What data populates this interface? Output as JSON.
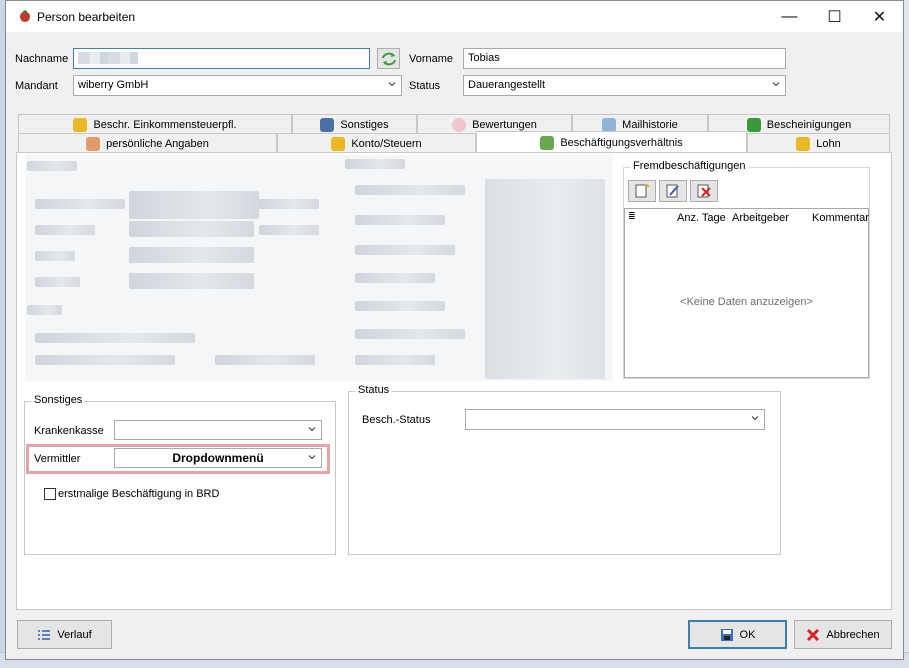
{
  "window": {
    "title": "Person bearbeiten",
    "minimize": "—",
    "maximize": "☐",
    "close": "✕"
  },
  "form": {
    "nachname_label": "Nachname",
    "vorname_label": "Vorname",
    "vorname_value": "Tobias",
    "mandant_label": "Mandant",
    "mandant_value": "wiberry GmbH",
    "status_label": "Status",
    "status_value": "Dauerangestellt"
  },
  "tabs_row1": [
    {
      "label": "Beschr. Einkommensteuerpfl.",
      "icon": "coins-icon"
    },
    {
      "label": "Sonstiges",
      "icon": "car-icon"
    },
    {
      "label": "Bewertungen",
      "icon": "heart-icon"
    },
    {
      "label": "Mailhistorie",
      "icon": "mail-icon"
    },
    {
      "label": "Bescheinigungen",
      "icon": "check-icon"
    }
  ],
  "tabs_row2": [
    {
      "label": "persönliche Angaben",
      "icon": "person-icon"
    },
    {
      "label": "Konto/Steuern",
      "icon": "coins-icon"
    },
    {
      "label": "Beschäftigungsverhältnis",
      "icon": "person-add-icon"
    },
    {
      "label": "Lohn",
      "icon": "coins-icon"
    }
  ],
  "fremd": {
    "title": "Fremdbeschäftigungen",
    "columns": [
      "Anz. Tage",
      "Arbeitgeber",
      "Kommentar"
    ],
    "empty": "<Keine Daten anzuzeigen>"
  },
  "sonstiges": {
    "title": "Sonstiges",
    "krankenkasse_label": "Krankenkasse",
    "vermittler_label": "Vermittler",
    "vermittler_value": "Dropdownmenü",
    "erstmalig_label": "erstmalige Beschäftigung in BRD"
  },
  "status_group": {
    "title": "Status",
    "besch_label": "Besch.-Status"
  },
  "buttons": {
    "verlauf": "Verlauf",
    "ok": "OK",
    "abbrechen": "Abbrechen"
  },
  "colors": {
    "highlight": "#e8a3a8",
    "focus_border": "#3c7fb1"
  }
}
